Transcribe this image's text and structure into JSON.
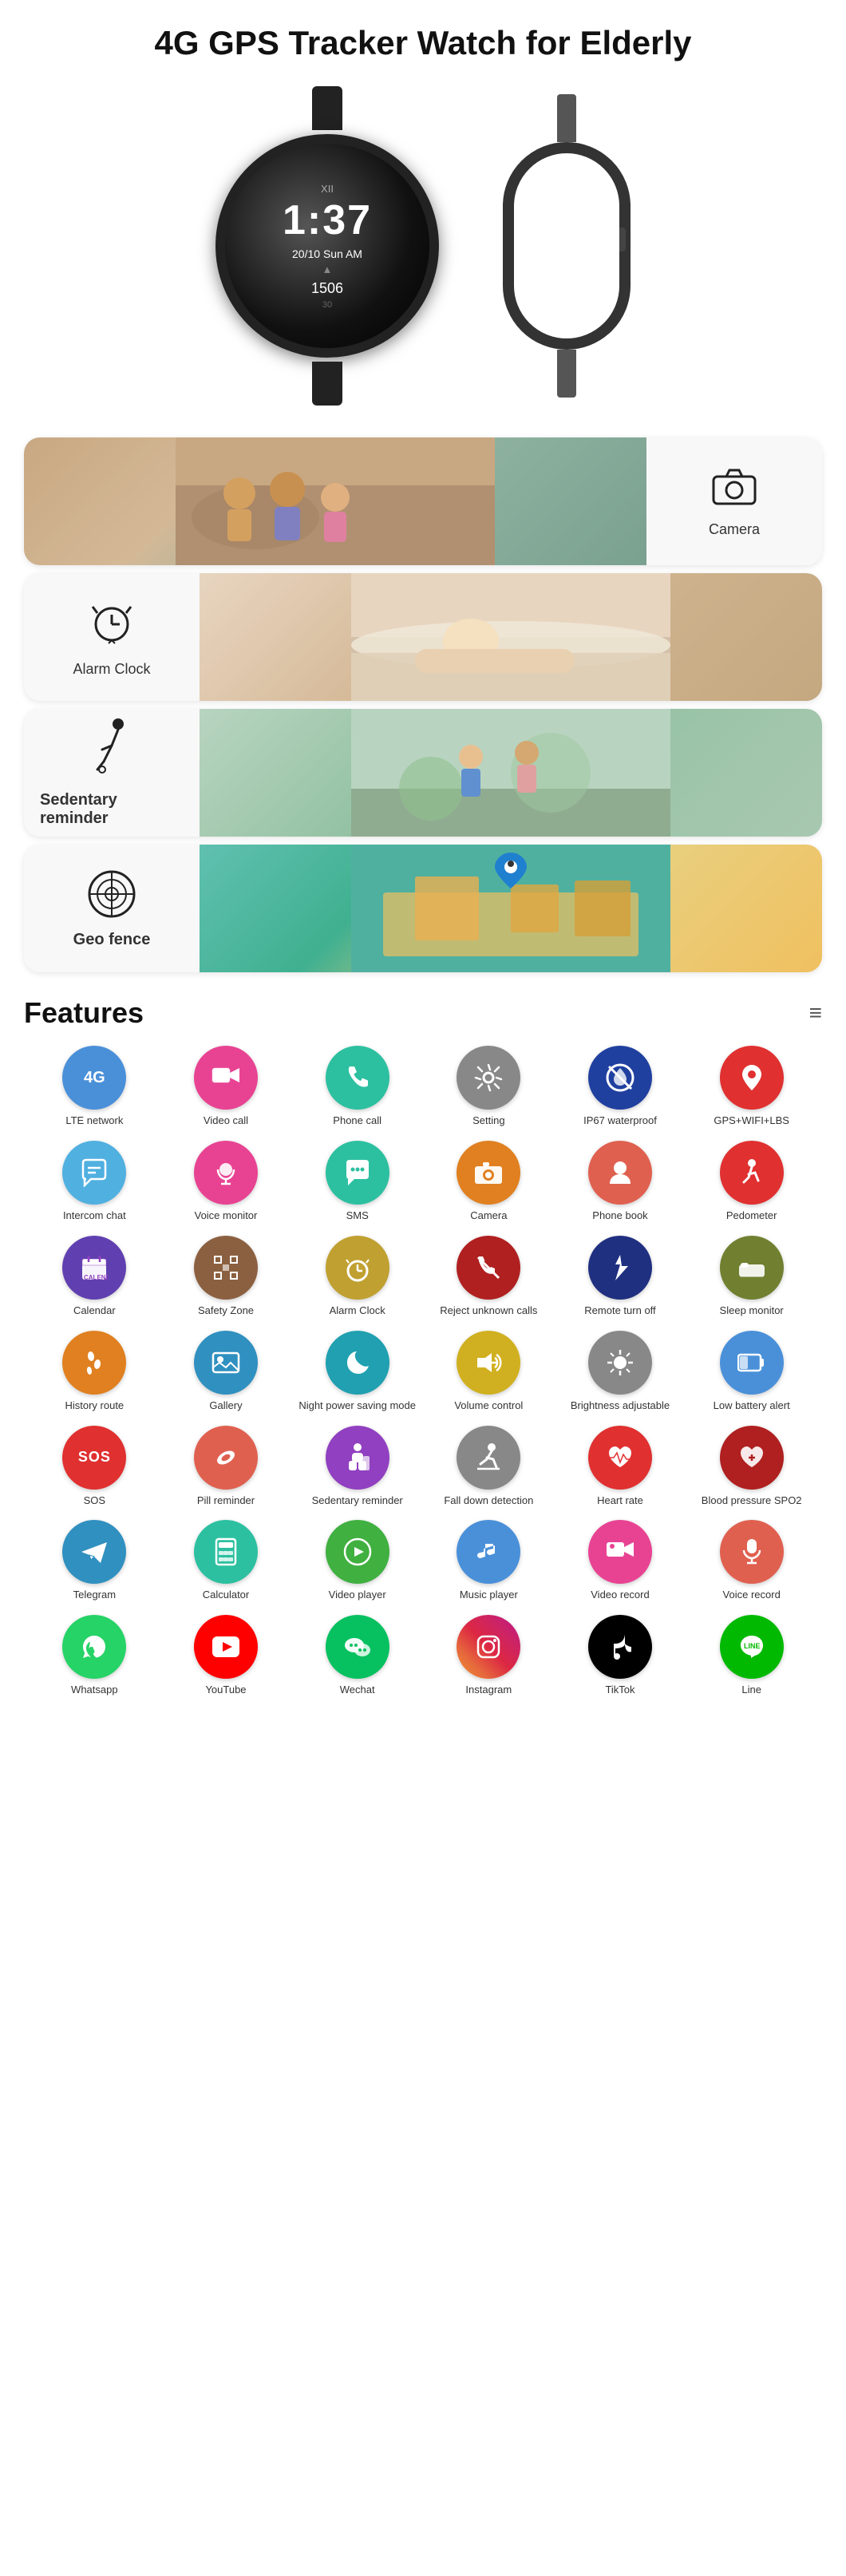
{
  "page": {
    "title": "4G GPS Tracker Watch for Elderly"
  },
  "watch": {
    "time": "1:37",
    "date": "20/10  Sun AM",
    "steps": "1506"
  },
  "feature_cards": [
    {
      "id": "camera",
      "label": "Camera",
      "icon": "📷",
      "image_class": "elderly-photo",
      "reverse": false
    },
    {
      "id": "alarm",
      "label": "Alarm Clock",
      "icon": "⏰",
      "image_class": "sleep-photo",
      "reverse": true
    },
    {
      "id": "sedentary",
      "label": "Sedentary reminder",
      "icon": "♿",
      "image_class": "sedentary-photo",
      "reverse": false
    },
    {
      "id": "geofence",
      "label": "Geo fence",
      "icon": "🔒",
      "image_class": "geofence-photo",
      "reverse": false
    }
  ],
  "features_section": {
    "title": "Features"
  },
  "features": [
    {
      "id": "lte",
      "label": "LTE network",
      "icon": "4G",
      "type": "text",
      "bg": "bg-blue"
    },
    {
      "id": "video-call",
      "label": "Video call",
      "icon": "📹",
      "bg": "bg-pink"
    },
    {
      "id": "phone-call",
      "label": "Phone call",
      "icon": "📞",
      "bg": "bg-teal"
    },
    {
      "id": "setting",
      "label": "Setting",
      "icon": "⚙️",
      "bg": "bg-gray"
    },
    {
      "id": "waterproof",
      "label": "IP67 waterproof",
      "icon": "🚫",
      "bg": "bg-darkblue"
    },
    {
      "id": "gps",
      "label": "GPS+WIFI+LBS",
      "icon": "📍",
      "bg": "bg-red"
    },
    {
      "id": "intercom",
      "label": "Intercom chat",
      "icon": "💬",
      "bg": "bg-lightblue"
    },
    {
      "id": "voice-monitor",
      "label": "Voice monitor",
      "icon": "🎧",
      "bg": "bg-pink"
    },
    {
      "id": "sms",
      "label": "SMS",
      "icon": "💬",
      "bg": "bg-teal"
    },
    {
      "id": "camera2",
      "label": "Camera",
      "icon": "📷",
      "bg": "bg-orange"
    },
    {
      "id": "phonebook",
      "label": "Phone book",
      "icon": "👤",
      "bg": "bg-salmon"
    },
    {
      "id": "pedometer",
      "label": "Pedometer",
      "icon": "🚶",
      "bg": "bg-red"
    },
    {
      "id": "calendar",
      "label": "Calendar",
      "icon": "📅",
      "bg": "bg-violet"
    },
    {
      "id": "safety-zone",
      "label": "Safety Zone",
      "icon": "⬛",
      "bg": "bg-brown"
    },
    {
      "id": "alarm-clock",
      "label": "Alarm Clock",
      "icon": "⏰",
      "bg": "bg-gold"
    },
    {
      "id": "reject-calls",
      "label": "Reject unknown calls",
      "icon": "📵",
      "bg": "bg-darkred"
    },
    {
      "id": "remote-turnoff",
      "label": "Remote turn off",
      "icon": "👆",
      "bg": "bg-navy"
    },
    {
      "id": "sleep-monitor",
      "label": "Sleep monitor",
      "icon": "😴",
      "bg": "bg-olive"
    },
    {
      "id": "history-route",
      "label": "History route",
      "icon": "👣",
      "bg": "bg-orange"
    },
    {
      "id": "gallery",
      "label": "Gallery",
      "icon": "🖼️",
      "bg": "bg-sky"
    },
    {
      "id": "night-power",
      "label": "Night power saving mode",
      "icon": "🌙",
      "bg": "bg-cyan"
    },
    {
      "id": "volume",
      "label": "Volume control",
      "icon": "🔊",
      "bg": "bg-yellow"
    },
    {
      "id": "brightness",
      "label": "Brightness adjustable",
      "icon": "☀️",
      "bg": "bg-gray"
    },
    {
      "id": "low-battery",
      "label": "Low battery alert",
      "icon": "🔋",
      "bg": "bg-blue"
    },
    {
      "id": "sos",
      "label": "SOS",
      "icon": "SOS",
      "type": "text",
      "bg": "bg-red"
    },
    {
      "id": "pill",
      "label": "Pill reminder",
      "icon": "💊",
      "bg": "bg-salmon"
    },
    {
      "id": "sedentary2",
      "label": "Sedentary reminder",
      "icon": "🪑",
      "bg": "bg-purple"
    },
    {
      "id": "fall-down",
      "label": "Fall down detection",
      "icon": "🚶",
      "bg": "bg-gray"
    },
    {
      "id": "heart-rate",
      "label": "Heart rate",
      "icon": "❤️",
      "bg": "bg-red"
    },
    {
      "id": "blood-pressure",
      "label": "Blood pressure SPO2",
      "icon": "🩸",
      "bg": "bg-darkred"
    },
    {
      "id": "telegram",
      "label": "Telegram",
      "icon": "✈️",
      "bg": "bg-sky"
    },
    {
      "id": "calculator",
      "label": "Calculator",
      "icon": "🔢",
      "bg": "bg-teal"
    },
    {
      "id": "video-player",
      "label": "Video player",
      "icon": "▶️",
      "bg": "bg-green"
    },
    {
      "id": "music-player",
      "label": "Music player",
      "icon": "🎵",
      "bg": "bg-blue"
    },
    {
      "id": "video-record",
      "label": "Video record",
      "icon": "🎬",
      "bg": "bg-pink"
    },
    {
      "id": "voice-record",
      "label": "Voice record",
      "icon": "🎙️",
      "bg": "bg-salmon"
    },
    {
      "id": "whatsapp",
      "label": "Whatsapp",
      "icon": "📱",
      "bg": "bg-whatsapp"
    },
    {
      "id": "youtube",
      "label": "YouTube",
      "icon": "▶",
      "type": "text-yt",
      "bg": "bg-youtube"
    },
    {
      "id": "wechat",
      "label": "Wechat",
      "icon": "💬",
      "bg": "bg-wechat"
    },
    {
      "id": "instagram",
      "label": "Instagram",
      "icon": "📷",
      "bg": "bg-instagram"
    },
    {
      "id": "tiktok",
      "label": "TikTok",
      "icon": "♪",
      "bg": "bg-tiktok"
    },
    {
      "id": "line",
      "label": "Line",
      "icon": "LINE",
      "type": "text",
      "bg": "bg-line"
    }
  ]
}
